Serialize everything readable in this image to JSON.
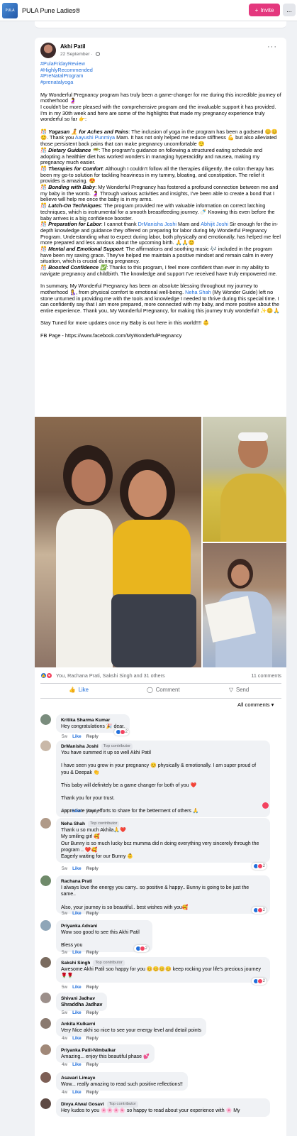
{
  "topbar": {
    "group_logo_text": "PULA",
    "group_name": "PULA Pune Ladies®",
    "invite_label": "Invite",
    "more_label": "..."
  },
  "post": {
    "author": "Akhi Patil",
    "date": "22 September",
    "more_menu": "···",
    "hashtags": [
      "#PulaFridayReview",
      "#HighlyRecommended",
      "#PreNatalProgram",
      "#prenatalyoga"
    ],
    "intro": [
      "My Wonderful Pregnancy program has truly been a game-changer for me during this incredible journey of motherhood 🤰",
      "I couldn't be more pleased with the comprehensive program and the invaluable support it has provided. I'm in my 30th week and here are some of the highlights that made my pregnancy experience truly wonderful so far 👉:"
    ],
    "highlights": [
      {
        "title": "Yogasan 🧘 for Aches and Pains",
        "text": ": The inclusion of yoga in the program has been a godsend 😊😊😊. Thank you ",
        "mention": "Aayushi Punmiya",
        "text2": " Mam. It has not only helped me reduce stiffness 💪 but also alleviated those persistent back pains that can make pregnancy uncomfortable 😌"
      },
      {
        "title": "Dietary Guidance 🥗",
        "text": ": The program's guidance on following a structured eating schedule and adopting a healthier diet has worked wonders in managing hyperacidity and nausea, making my pregnancy much easier.",
        "mention": "",
        "text2": ""
      },
      {
        "title": "Therapies for Comfort",
        "text": ": Although I couldn't follow all the therapies diligently, the colon therapy has been my go-to solution for tackling heaviness in my tummy, bloating, and constipation. The relief it provides is amazing. 😍",
        "mention": "",
        "text2": ""
      },
      {
        "title": "Bonding with Baby",
        "text": ": My Wonderful Pregnancy has fostered a profound connection between me and my baby in the womb. 🤰 Through various activities and insights, I've been able to create a bond that I believe will help me once the baby is in my arms.",
        "mention": "",
        "text2": ""
      },
      {
        "title": "Latch-On Techniques",
        "text": ": The program provided me with valuable information on correct latching techniques, which is instrumental for a smooth breastfeeding journey. 🍼 Knowing this even before the baby arrives is a big confidence booster.",
        "mention": "",
        "text2": ""
      },
      {
        "title": "Preparation for Labor",
        "text": ": I cannot thank ",
        "mention": "DrManisha Joshi",
        "text2": " Mam and ",
        "mention2": "Abhijit Joshi",
        "text3": " Sir enough for the in-depth knowledge and guidance they offered on preparing for labor during My Wonderful Pregnancy Program. Understanding what to expect during labor, both physically and emotionally, has helped me feel more prepared and less anxious about the upcoming birth. 🙏🙏😊"
      },
      {
        "title": "Mental and Emotional Support",
        "text": ": The affirmations and soothing music 🎶 included in the program have been my saving grace. They've helped me maintain a positive mindset and remain calm in every situation, which is crucial during pregnancy.",
        "mention": "",
        "text2": ""
      },
      {
        "title": "Boosted Confidence ✅",
        "text": ": Thanks to this program, I feel more confident than ever in my ability to navigate pregnancy and childbirth. The knowledge and support I've received have truly empowered me.",
        "mention": "",
        "text2": ""
      }
    ],
    "summary_pre": "In summary, My Wonderful Pregnancy has been an absolute blessing throughout my journey to motherhood 🤱, from physical comfort to emotional well-being. ",
    "summary_mention": "Neha Shah",
    "summary_post": " (My Wonder Guide) left no stone unturned in providing me with the tools and knowledge I needed to thrive during this special time. I can confidently say that I am more prepared, more connected with my baby, and more positive about the entire experience. Thank you, My Wonderful Pregnancy, for making this journey truly wonderful! ✨😊🙏",
    "stay_tuned": "Stay Tuned for more updates once my Baby is out here in this world!!!! 👶",
    "fb_page": "FB Page - https://www.facebook.com/MyWonderfulPregnancy",
    "reactions_text": "You, Rachana Prati, Sakshi Singh and 31 others",
    "comments_count": "11 comments",
    "like_label": "Like",
    "comment_label": "Comment",
    "send_label": "Send",
    "all_comments_label": "All comments ▾"
  },
  "comments": [
    {
      "name": "Kritika Sharma Kumar",
      "badge": "",
      "lines": [
        "Hey congratulations 🎉 dear."
      ],
      "time": "5w",
      "like": "Like",
      "reply": "Reply",
      "reactions": "2"
    },
    {
      "name": "DrManisha Joshi",
      "badge": "Top contributor",
      "lines": [
        "You have summed it up so well Akhi Patil",
        "",
        "I have seen you grow in your pregnancy 😊 physically & emotionally. I am super proud of you & Deepak 👏",
        "",
        "This baby will definitely be a game changer for both of you ❤️",
        "",
        "Thank you for your trust.",
        "",
        "Appreciate your efforts to share for the betterment of others 🙏"
      ],
      "time": "5w",
      "like": "Like",
      "reply": "Reply",
      "reactions": ""
    },
    {
      "name": "Neha Shah",
      "badge": "Top contributor",
      "lines": [
        "Thank u so much Akhila🙏❤️",
        "My smiling girl 🥰",
        "Our Bunny is so much lucky bcz mumma did n doing everything very sincerely through the program .. ❤️🥰",
        "Eagerly waiting for our Bunny 👶"
      ],
      "time": "5w",
      "like": "Like",
      "reply": "Reply",
      "reactions": "2"
    },
    {
      "name": "Rachana Prati",
      "badge": "",
      "lines": [
        "I always love the energy you carry.. so positive & happy.. Bunny is going to be just the same..",
        "",
        "Also, your journey is so beautiful.. best wishes with you🥰"
      ],
      "time": "5w",
      "like": "Like",
      "reply": "Reply",
      "reactions": "2"
    },
    {
      "name": "Priyanka Advani",
      "badge": "",
      "lines": [
        "Wow soo good to see this Akhi Patil",
        "",
        "Bless you"
      ],
      "time": "5w",
      "like": "Like",
      "reply": "Reply",
      "reactions": "2"
    },
    {
      "name": "Sakshi Singh",
      "badge": "Top contributor",
      "lines": [
        "Awesome Akhi Patil soo happy for you 😊😊😊😊 keep rocking your life's precious journey 🌹🌹"
      ],
      "time": "5w",
      "like": "Like",
      "reply": "Reply",
      "reactions": "2"
    },
    {
      "name": "Shivani Jadhav",
      "badge": "",
      "lines": [
        "Shraddha Jadhav"
      ],
      "time": "5w",
      "like": "Like",
      "reply": "Reply",
      "reactions": ""
    },
    {
      "name": "Ankita Kulkarni",
      "badge": "",
      "lines": [
        "Very Nice akhi so nice to see your energy level and detail points"
      ],
      "time": "4w",
      "like": "Like",
      "reply": "Reply",
      "reactions": ""
    },
    {
      "name": "Priyanka Patil-Nimbalkar",
      "badge": "",
      "lines": [
        "Amazing... enjoy this beautiful phase 💕"
      ],
      "time": "4w",
      "like": "Like",
      "reply": "Reply",
      "reactions": ""
    },
    {
      "name": "Asavari Limaye",
      "badge": "",
      "lines": [
        "Wow... really amazing to read such positive reflections!!"
      ],
      "time": "4w",
      "like": "Like",
      "reply": "Reply",
      "reactions": ""
    },
    {
      "name": "Divya Atwal Gosavi",
      "badge": "Top contributor",
      "lines": [
        "Hey kudos to you 🌸🌸🌸🌸 so happy to read about your experience with 🌸 My"
      ],
      "time": "",
      "like": "",
      "reply": "",
      "reactions": ""
    }
  ],
  "colors": {
    "link": "#216fdb",
    "invite": "#e4387e",
    "like_blue": "#216fdb",
    "heart_red": "#f3425f"
  }
}
